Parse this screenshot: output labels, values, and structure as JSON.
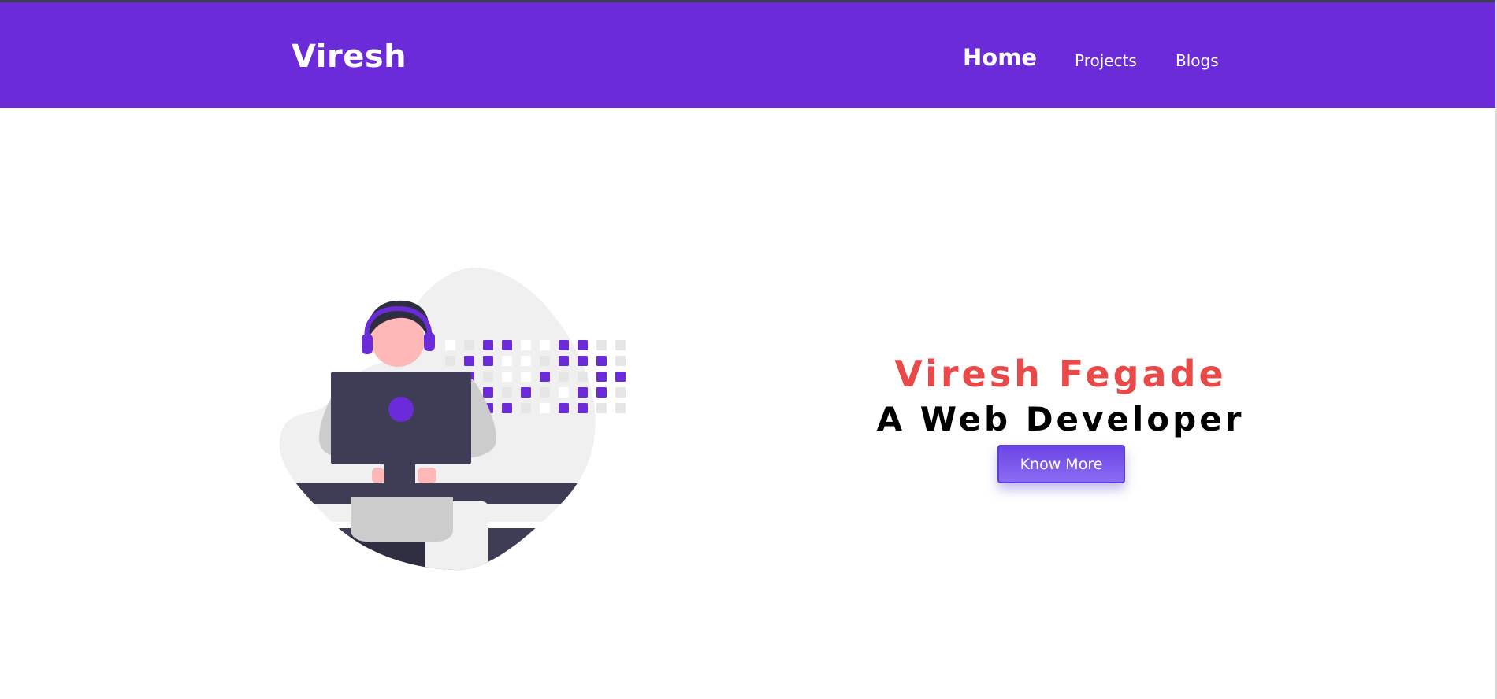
{
  "navbar": {
    "brand": "Viresh",
    "links": [
      {
        "label": "Home"
      },
      {
        "label": "Projects"
      },
      {
        "label": "Blogs"
      }
    ]
  },
  "hero": {
    "name": "Viresh Fegade",
    "role": "A Web Developer",
    "button_label": "Know More",
    "illustration_icon": "developer-at-computer-illustration"
  },
  "colors": {
    "primary": "#6c2bd9",
    "name_accent": "#e84a4a",
    "dark": "#3f3d56"
  }
}
